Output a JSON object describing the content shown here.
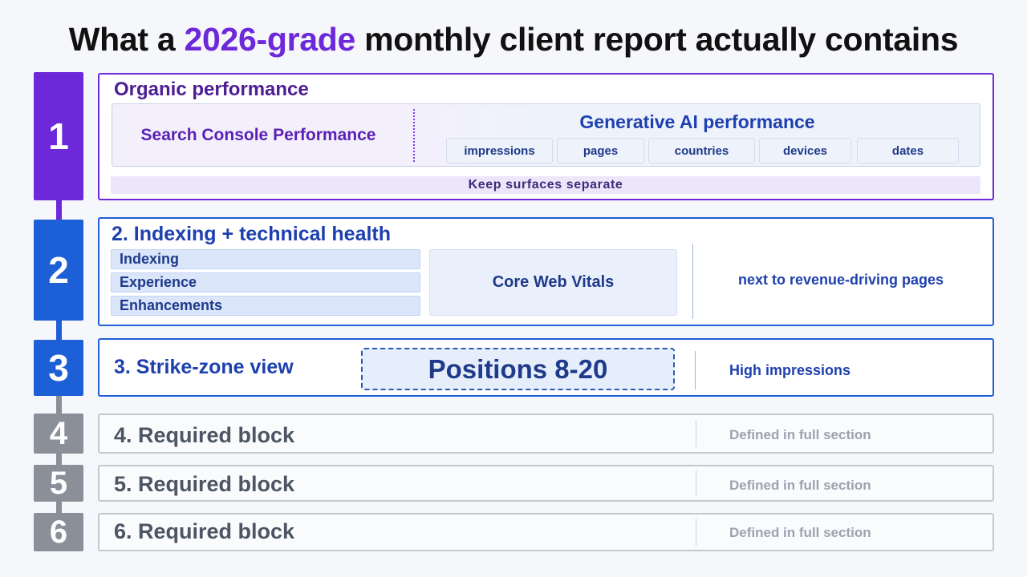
{
  "title": {
    "prefix": "What a",
    "accent": "2026-grade",
    "suffix": "monthly client report actually contains"
  },
  "colors": {
    "purple": "#6d28d9",
    "blue": "#1d5fd6",
    "gray": "#8a8f98"
  },
  "steps": [
    {
      "number": "1",
      "heading": "Organic performance",
      "left_panel": "Search Console Performance",
      "right_panel": {
        "heading": "Generative AI performance",
        "chips": [
          "impressions",
          "pages",
          "countries",
          "devices",
          "dates"
        ]
      },
      "footer": "Keep surfaces separate"
    },
    {
      "number": "2",
      "heading": "2. Indexing + technical health",
      "items": [
        "Indexing",
        "Experience",
        "Enhancements"
      ],
      "center": "Core Web Vitals",
      "note": "next to revenue-driving pages"
    },
    {
      "number": "3",
      "heading": "3. Strike-zone view",
      "highlight": "Positions 8-20",
      "note": "High impressions"
    },
    {
      "number": "4",
      "heading": "4. Required block",
      "note": "Defined in full section"
    },
    {
      "number": "5",
      "heading": "5. Required block",
      "note": "Defined in full section"
    },
    {
      "number": "6",
      "heading": "6. Required block",
      "note": "Defined in full section"
    }
  ]
}
